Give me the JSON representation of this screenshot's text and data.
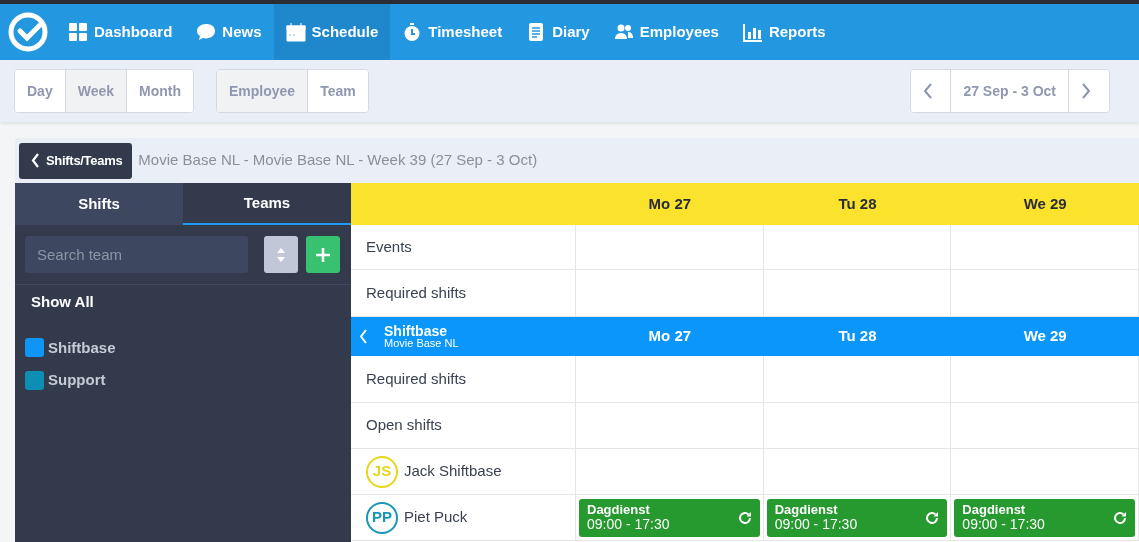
{
  "nav": {
    "items": [
      {
        "label": "Dashboard",
        "selected": false
      },
      {
        "label": "News",
        "selected": false
      },
      {
        "label": "Schedule",
        "selected": true
      },
      {
        "label": "Timesheet",
        "selected": false
      },
      {
        "label": "Diary",
        "selected": false
      },
      {
        "label": "Employees",
        "selected": false
      },
      {
        "label": "Reports",
        "selected": false
      }
    ]
  },
  "toolbar": {
    "period_buttons": [
      {
        "label": "Day",
        "selected": false
      },
      {
        "label": "Week",
        "selected": true
      },
      {
        "label": "Month",
        "selected": false
      }
    ],
    "mode_buttons": [
      {
        "label": "Employee",
        "selected": true
      },
      {
        "label": "Team",
        "selected": false
      }
    ],
    "date_range": "27 Sep - 3 Oct"
  },
  "breadcrumb": {
    "back_label": "Shifts/Teams",
    "title": "Movie Base NL - Movie Base NL - Week 39 (27 Sep - 3 Oct)"
  },
  "sidebar": {
    "tabs": [
      {
        "label": "Shifts",
        "selected": false
      },
      {
        "label": "Teams",
        "selected": true
      }
    ],
    "search": {
      "placeholder": "Search team"
    },
    "show_all": "Show All",
    "teams": [
      {
        "name": "Shiftbase",
        "color": "#0f95f5"
      },
      {
        "name": "Support",
        "color": "#0d8eb5"
      }
    ]
  },
  "schedule": {
    "days": [
      "Mo 27",
      "Tu 28",
      "We 29"
    ],
    "top_rows": [
      {
        "label": "Events"
      },
      {
        "label": "Required shifts"
      }
    ],
    "team": {
      "name": "Shiftbase",
      "subtitle": "Movie Base NL",
      "days": [
        "Mo 27",
        "Tu 28",
        "We 29"
      ]
    },
    "rows": [
      {
        "kind": "label",
        "label": "Required shifts"
      },
      {
        "kind": "label",
        "label": "Open shifts"
      },
      {
        "kind": "employee",
        "initials": "JS",
        "name": "Jack Shiftbase",
        "color": "#e6d61a"
      },
      {
        "kind": "employee",
        "initials": "PP",
        "name": "Piet Puck",
        "color": "#1796ba",
        "shifts": [
          {
            "title": "Dagdienst",
            "time": "09:00 - 17:30"
          },
          {
            "title": "Dagdienst",
            "time": "09:00 - 17:30"
          },
          {
            "title": "Dagdienst",
            "time": "09:00 - 17:30"
          }
        ]
      }
    ]
  }
}
